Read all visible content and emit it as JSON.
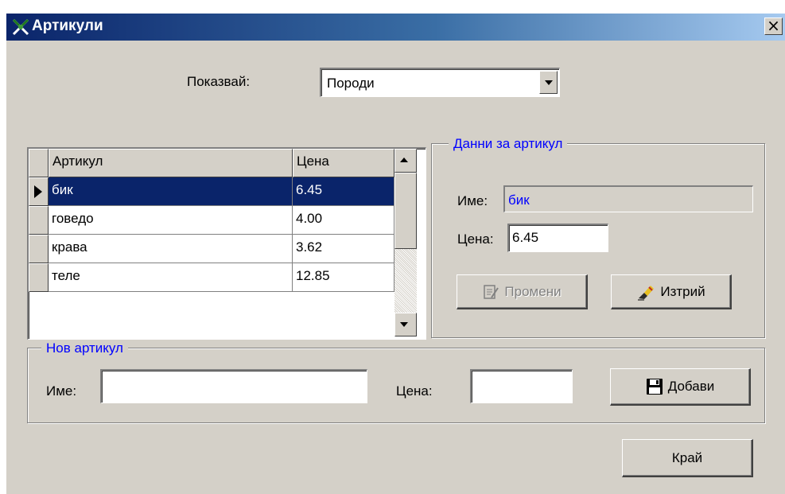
{
  "window": {
    "title": "Артикули",
    "title_icon": "tools-icon",
    "close_glyph": "×"
  },
  "filter": {
    "label": "Показвай:",
    "selected": "Породи"
  },
  "grid": {
    "columns": [
      "Артикул",
      "Цена"
    ],
    "rows": [
      {
        "name": "бик",
        "price": "6.45",
        "selected": true
      },
      {
        "name": "говедо",
        "price": "4.00"
      },
      {
        "name": "крава",
        "price": "3.62"
      },
      {
        "name": "теле",
        "price": "12.85"
      }
    ]
  },
  "details": {
    "legend": "Данни за артикул",
    "name_label": "Име:",
    "name_value": "бик",
    "price_label": "Цена:",
    "price_value": "6.45",
    "edit_button": "Промени",
    "edit_icon": "edit-document-icon",
    "delete_button": "Изтрий",
    "delete_icon": "eraser-icon"
  },
  "new_item": {
    "legend": "Нов артикул",
    "name_label": "Име:",
    "name_value": "",
    "price_label": "Цена:",
    "price_value": "",
    "add_button": "Добави",
    "add_icon": "floppy-disk-icon"
  },
  "footer": {
    "close_button": "Край"
  },
  "colors": {
    "title_start": "#0a246a",
    "title_end": "#a6caf0",
    "selection": "#0a246a",
    "legend_text": "#0000ff",
    "face": "#d4d0c8"
  }
}
